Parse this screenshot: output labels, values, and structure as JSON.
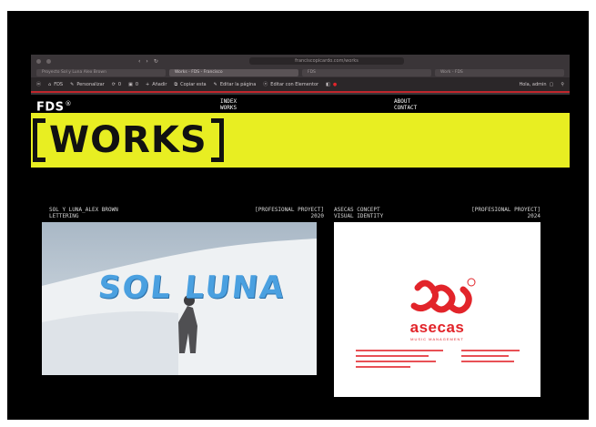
{
  "browser": {
    "url": "franciscopicardo.com/works",
    "tabs": [
      {
        "label": "Proyecto Sol y Luna Alex Brown",
        "active": false
      },
      {
        "label": "Works - FDS - Francisco",
        "active": true
      },
      {
        "label": "FDS",
        "active": false
      },
      {
        "label": "Work - FDS",
        "active": false
      }
    ],
    "adminbar": {
      "site_name": "FDS",
      "customize": "Personalizar",
      "comments_count": "0",
      "updates_count": "0",
      "new_item": "Añadir",
      "copy_item": "Copiar esta",
      "edit_page": "Editar la página",
      "edit_elementor": "Editar con Elementor",
      "greeting": "Hola, admin"
    }
  },
  "site": {
    "logo": "FDS",
    "logo_mark": "®",
    "nav_left": [
      "INDEX",
      "WORKS"
    ],
    "nav_right": [
      "ABOUT",
      "CONTACT"
    ],
    "banner_title": "WORKS",
    "colors": {
      "banner": "#e8ee22",
      "brand_red": "#e2242a",
      "background": "#000000"
    }
  },
  "projects": [
    {
      "title": "SOL Y LUNA_ALEX BROWN",
      "subtitle": "LETTERING",
      "category": "[PROFESIONAL PROYECT]",
      "year": "2020",
      "image_text": "SOL LUNA"
    },
    {
      "title": "ASECAS CONCEPT",
      "subtitle": "VISUAL IDENTITY",
      "category": "[PROFESIONAL PROYECT]",
      "year": "2024",
      "brand_name": "asecas",
      "brand_tagline": "MUSIC MANAGEMENT"
    }
  ]
}
